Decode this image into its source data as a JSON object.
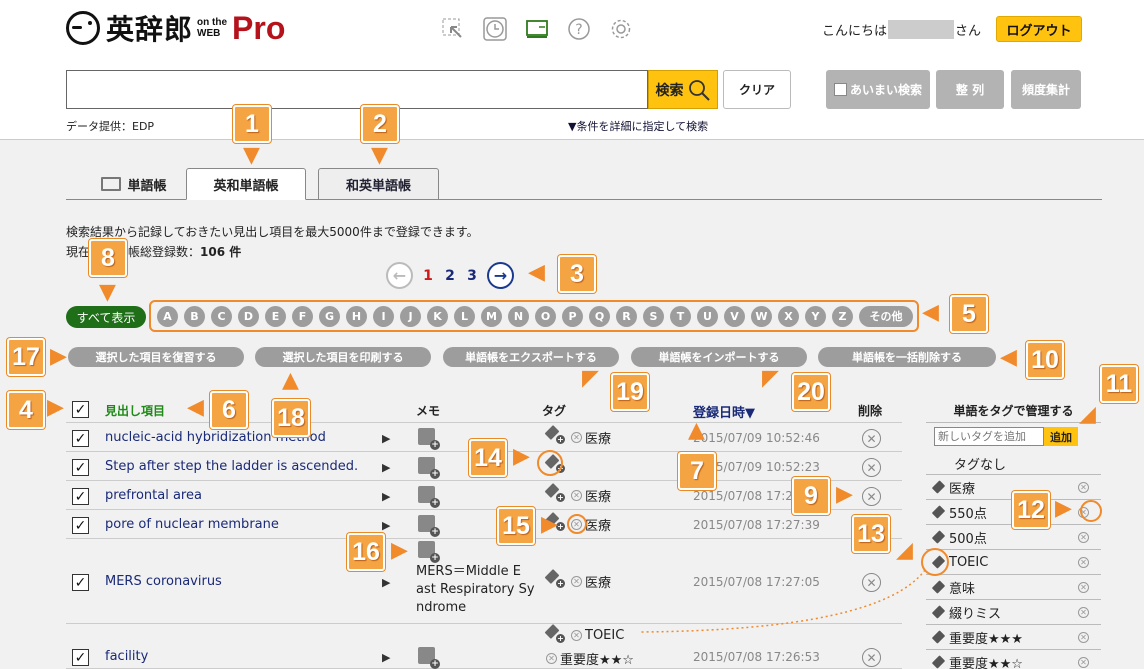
{
  "header": {
    "logo_main": "英辞郎",
    "logo_small": "on the WEB",
    "logo_pro": "Pro",
    "greeting_prefix": "こんにちは",
    "greeting_suffix": "さん",
    "logout": "ログアウト",
    "tool_icons": [
      "select-icon",
      "clock-icon",
      "monitor-icon",
      "help-icon",
      "gear-icon"
    ]
  },
  "search": {
    "value": "",
    "search_label": "検索",
    "clear_label": "クリア",
    "fuzzy_label": "あいまい検索",
    "sort_label": "整 列",
    "freq_label": "頻度集計",
    "provider": "データ提供：EDP",
    "detail_link": "▼条件を詳細に指定して検索"
  },
  "tabs": {
    "wordbook": "単語帳",
    "eiwa": "英和単語帳",
    "waei": "和英単語帳"
  },
  "info": {
    "line1": "検索結果から記録しておきたい見出し項目を最大5000件まで登録できます。",
    "line2_prefix": "現在",
    "line2_mid": "語帳総登録数：",
    "count": "106 件"
  },
  "pager": {
    "pages": [
      "1",
      "2",
      "3"
    ],
    "current": "1"
  },
  "alphabet": {
    "all": "すべて表示",
    "letters": [
      "A",
      "B",
      "C",
      "D",
      "E",
      "F",
      "G",
      "H",
      "I",
      "J",
      "K",
      "L",
      "M",
      "N",
      "O",
      "P",
      "Q",
      "R",
      "S",
      "T",
      "U",
      "V",
      "W",
      "X",
      "Y",
      "Z"
    ],
    "other": "その他"
  },
  "actions": {
    "restore": "選択した項目を復習する",
    "print": "選択した項目を印刷する",
    "export": "単語帳をエクスポートする",
    "import": "単語帳をインポートする",
    "delete_all": "単語帳を一括削除する"
  },
  "table": {
    "headers": {
      "heading": "見出し項目",
      "memo": "メモ",
      "tag": "タグ",
      "date": "登録日時▼",
      "delete": "削除"
    },
    "rows": [
      {
        "word": "nucleic-acid hybridization method",
        "tags": [
          "医療"
        ],
        "date": "2015/07/09 10:52:46"
      },
      {
        "word": "Step after step the ladder is ascended.",
        "tags": [],
        "date": "2015/07/09 10:52:23"
      },
      {
        "word": "prefrontal area",
        "tags": [
          "医療"
        ],
        "date": "2015/07/08 17:29"
      },
      {
        "word": "pore of nuclear membrane",
        "tags": [
          "医療"
        ],
        "date": "2015/07/08 17:27:39"
      },
      {
        "word": "MERS coronavirus",
        "memo": [
          "MERS＝Middle E",
          "ast Respiratory Sy",
          "ndrome"
        ],
        "tags": [
          "医療"
        ],
        "date": "2015/07/08 17:27:05"
      },
      {
        "word": "facility",
        "tags": [
          "TOEIC",
          "重要度★★☆"
        ],
        "date": "2015/07/08 17:26:53"
      }
    ]
  },
  "tag_panel": {
    "title": "単語をタグで管理する",
    "new_placeholder": "新しいタグを追加",
    "add": "追加",
    "none": "タグなし",
    "tags": [
      "医療",
      "550点",
      "500点",
      "TOEIC",
      "意味",
      "綴りミス",
      "重要度★★★",
      "重要度★★☆"
    ]
  },
  "callouts": [
    "1",
    "2",
    "3",
    "4",
    "5",
    "6",
    "7",
    "8",
    "9",
    "10",
    "11",
    "12",
    "13",
    "14",
    "15",
    "16",
    "17",
    "18",
    "19",
    "20"
  ],
  "colors": {
    "accent": "#ffc30f",
    "callout": "#f4a443",
    "all_button": "#1f6e18",
    "link": "#1a2a77",
    "pro": "#b5121b"
  }
}
